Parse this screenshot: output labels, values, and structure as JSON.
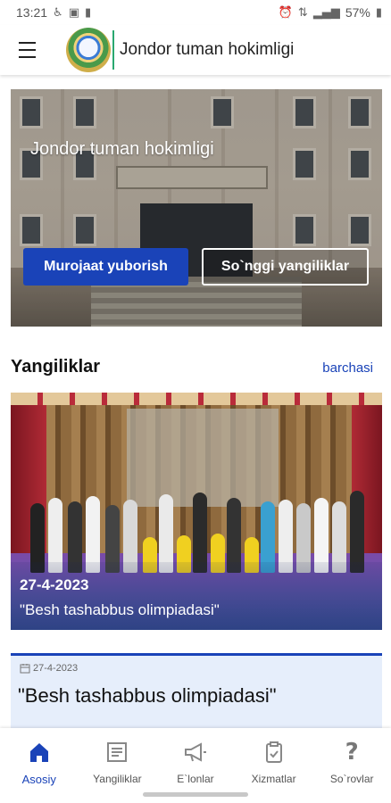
{
  "status_bar": {
    "time": "13:21",
    "battery": "57%",
    "left_icons": [
      "accessibility-icon",
      "image-icon",
      "sim-icon"
    ],
    "right_icons": [
      "alarm-icon",
      "data-icon",
      "signal-icon",
      "battery-icon"
    ]
  },
  "app_bar": {
    "title": "Jondor tuman hokimligi",
    "menu_icon": "menu-icon",
    "logo_icon": "emblem-logo"
  },
  "hero": {
    "title": "Jondor tuman hokimligi",
    "primary_button": "Murojaat yuborish",
    "secondary_button": "So`nggi yangiliklar"
  },
  "news_section": {
    "title": "Yangiliklar",
    "see_all": "barchasi"
  },
  "featured_news": {
    "date": "27-4-2023",
    "caption": "\"Besh tashabbus olimpiadasi\""
  },
  "news_card": {
    "date": "27-4-2023",
    "title": "\"Besh tashabbus olimpiadasi\""
  },
  "bottom_nav": {
    "items": [
      {
        "label": "Asosiy",
        "icon": "home-icon",
        "active": true
      },
      {
        "label": "Yangiliklar",
        "icon": "news-icon",
        "active": false
      },
      {
        "label": "E`lonlar",
        "icon": "megaphone-icon",
        "active": false
      },
      {
        "label": "Xizmatlar",
        "icon": "clipboard-icon",
        "active": false
      },
      {
        "label": "So`rovlar",
        "icon": "question-icon",
        "active": false
      }
    ]
  },
  "colors": {
    "accent": "#1a43b8",
    "card_bg": "#e6eefb"
  }
}
